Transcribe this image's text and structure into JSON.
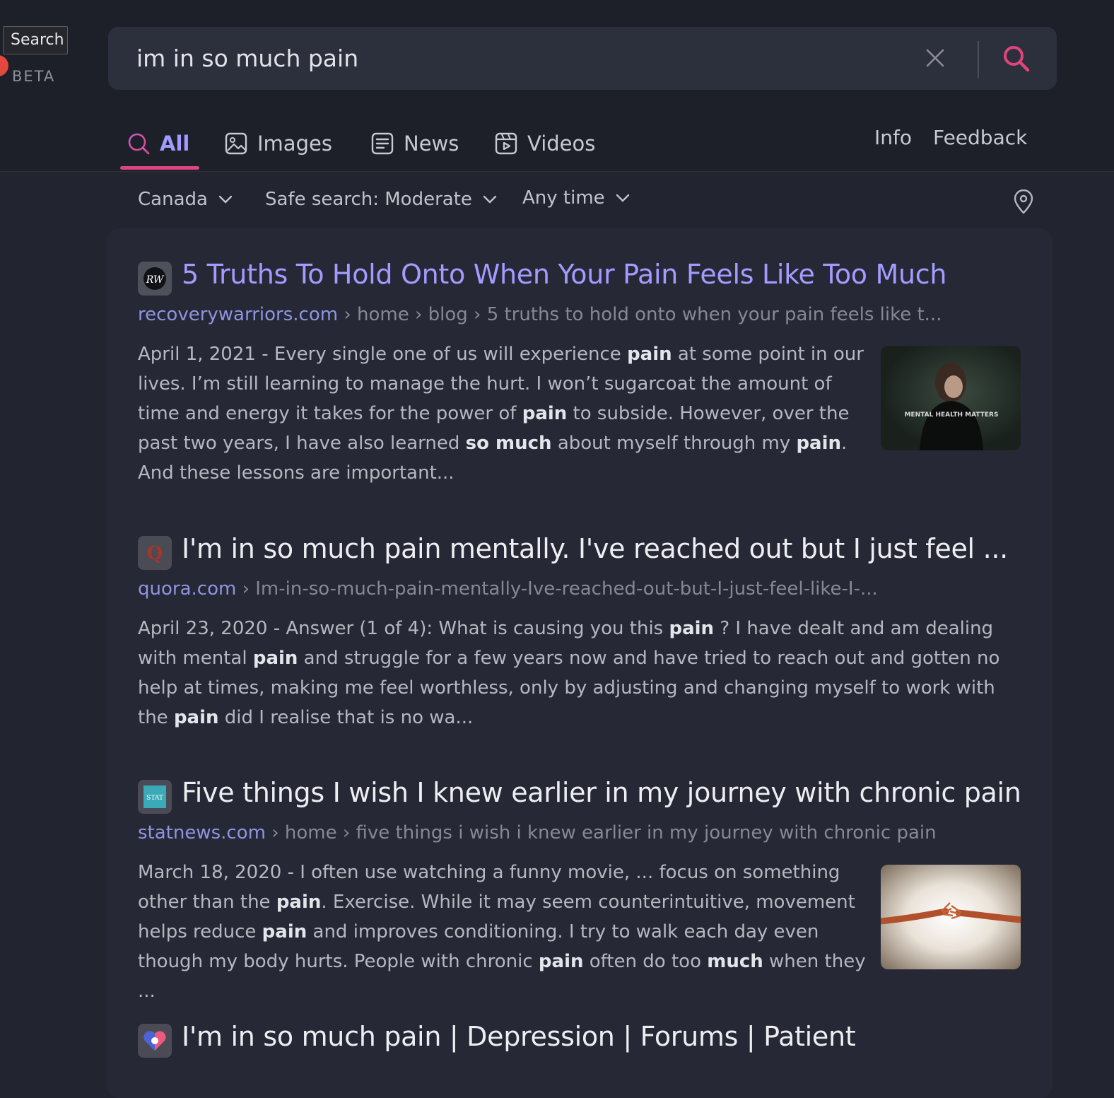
{
  "tooltip": "Search",
  "brand": {
    "badge": "BETA"
  },
  "search": {
    "query": "im in so much pain"
  },
  "tabs": [
    {
      "label": "All",
      "icon": "search-icon",
      "active": true
    },
    {
      "label": "Images",
      "icon": "image-icon"
    },
    {
      "label": "News",
      "icon": "news-icon"
    },
    {
      "label": "Videos",
      "icon": "video-icon"
    }
  ],
  "links": {
    "info": "Info",
    "feedback": "Feedback"
  },
  "filters": {
    "region": "Canada",
    "safe_search": "Safe search: Moderate",
    "time": "Any time"
  },
  "results": [
    {
      "title": "5 Truths To Hold Onto When Your Pain Feels Like Too Much",
      "domain": "recoverywarriors.com",
      "path": " › home › blog › 5 truths to hold onto when your pain feels like t...",
      "favicon": "RW",
      "visited": true,
      "thumbnail": "woman-in-mental-health-matters-shirt",
      "thumbnail_text": "MENTAL HEALTH MATTERS",
      "snippet": [
        {
          "t": "April 1, 2021 - Every single one of us will experience "
        },
        {
          "t": "pain",
          "b": true
        },
        {
          "t": " at some point in our lives. I’m still learning to manage the hurt. I won’t sugarcoat the amount of time and energy it takes for the power of "
        },
        {
          "t": "pain",
          "b": true
        },
        {
          "t": " to subside. However, over the past two years, I have also learned "
        },
        {
          "t": "so much",
          "b": true
        },
        {
          "t": " about myself through my "
        },
        {
          "t": "pain",
          "b": true
        },
        {
          "t": ". And these lessons are important..."
        }
      ]
    },
    {
      "title": "I'm in so much pain mentally. I've reached out but I just feel ...",
      "domain": "quora.com",
      "path": " › Im-in-so-much-pain-mentally-Ive-reached-out-but-I-just-feel-like-I-...",
      "favicon": "Q",
      "visited": false,
      "snippet": [
        {
          "t": "April 23, 2020 - Answer (1 of 4): What is causing you this "
        },
        {
          "t": "pain",
          "b": true
        },
        {
          "t": " ? I have dealt and am dealing with mental "
        },
        {
          "t": "pain",
          "b": true
        },
        {
          "t": " and struggle for a few years now and have tried to reach out and gotten no help at times, making me feel worthless, only by adjusting and changing myself to work with the "
        },
        {
          "t": "pain",
          "b": true
        },
        {
          "t": " did I realise that is no wa..."
        }
      ]
    },
    {
      "title": "Five things I wish I knew earlier in my journey with chronic pain",
      "domain": "statnews.com",
      "path": " › home › five things i wish i knew earlier in my journey with chronic pain",
      "favicon": "STAT",
      "visited": false,
      "thumbnail": "fraying-rope",
      "snippet": [
        {
          "t": "March 18, 2020 - I often use watching a funny movie, ... focus on something other than the "
        },
        {
          "t": "pain",
          "b": true
        },
        {
          "t": ". Exercise. While it may seem counterintuitive, movement helps reduce "
        },
        {
          "t": "pain",
          "b": true
        },
        {
          "t": " and improves conditioning. I try to walk each day even though my body hurts. People with chronic "
        },
        {
          "t": "pain",
          "b": true
        },
        {
          "t": " often do too "
        },
        {
          "t": "much",
          "b": true
        },
        {
          "t": " when they ..."
        }
      ]
    },
    {
      "title": "I'm in so much pain | Depression | Forums | Patient",
      "domain": "",
      "path": "",
      "favicon": "patient-heart",
      "visited": false,
      "snippet": []
    }
  ],
  "colors": {
    "accent": "#a39bff",
    "tab_underline": "#d9457f",
    "search_icon": "#e0457a",
    "background": "#22242f"
  }
}
